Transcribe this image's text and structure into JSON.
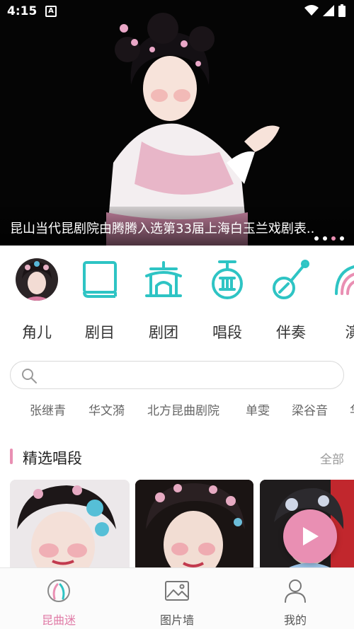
{
  "status_bar": {
    "time": "4:15",
    "notification_letter": "A"
  },
  "banner": {
    "caption": "昆山当代昆剧院由腾腾入选第33届上海白玉兰戏剧表..",
    "dots_total": 4,
    "active_dot": 3
  },
  "categories": [
    {
      "label": "角儿",
      "icon": "performer-avatar"
    },
    {
      "label": "剧目",
      "icon": "book-icon"
    },
    {
      "label": "剧团",
      "icon": "theater-building-icon"
    },
    {
      "label": "唱段",
      "icon": "instrument-icon"
    },
    {
      "label": "伴奏",
      "icon": "pipa-icon"
    },
    {
      "label": "演",
      "icon": "fan-icon"
    }
  ],
  "search": {
    "placeholder": ""
  },
  "tags": [
    "张继青",
    "华文漪",
    "北方昆曲剧院",
    "单雯",
    "梁谷音",
    "华"
  ],
  "section": {
    "title": "精选唱段",
    "more_label": "全部"
  },
  "colors": {
    "accent": "#e98fb3",
    "icon_teal": "#2ec4c4"
  },
  "bottom_nav": [
    {
      "label": "昆曲迷",
      "icon": "kunqu-icon",
      "active": true
    },
    {
      "label": "图片墙",
      "icon": "image-icon",
      "active": false
    },
    {
      "label": "我的",
      "icon": "user-icon",
      "active": false
    }
  ]
}
